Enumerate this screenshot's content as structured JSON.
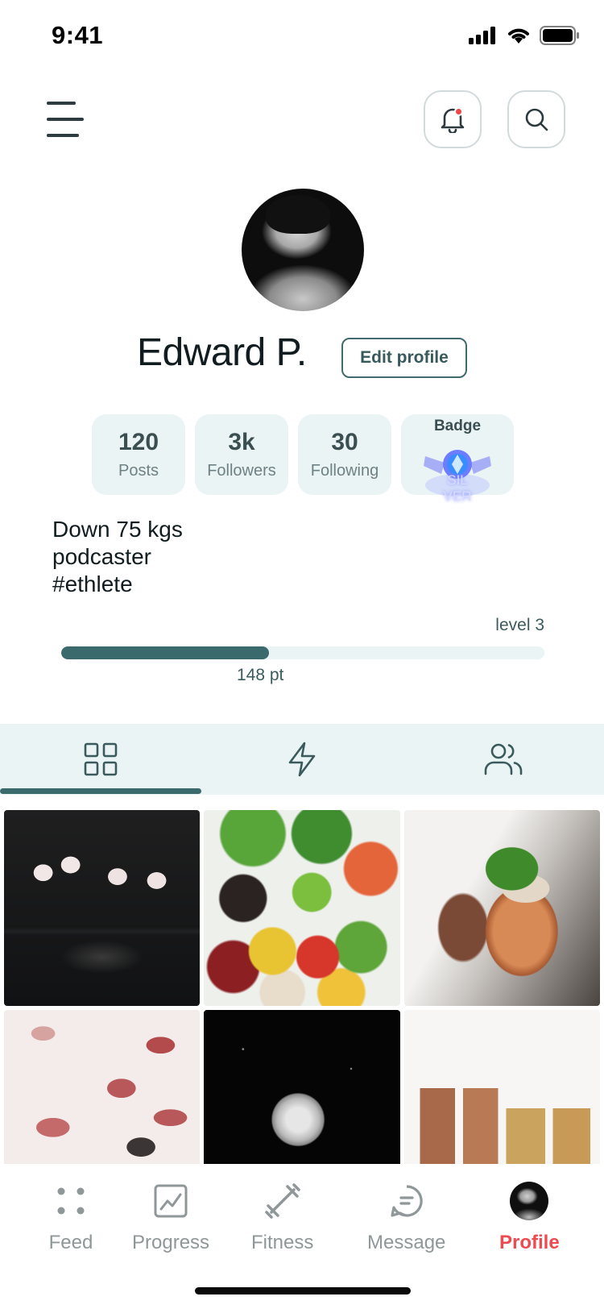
{
  "status_bar": {
    "time": "9:41"
  },
  "profile": {
    "name": "Edward P.",
    "edit_label": "Edit profile"
  },
  "stats": [
    {
      "value": "120",
      "label": "Posts"
    },
    {
      "value": "3k",
      "label": "Followers"
    },
    {
      "value": "30",
      "label": "Following"
    }
  ],
  "badge": {
    "label": "Badge",
    "text": "SIL\nVER"
  },
  "bio": [
    "Down 75 kgs",
    "podcaster",
    "#ethlete"
  ],
  "level": {
    "label": "level 3",
    "points": "148 pt",
    "progress_fraction": 0.43
  },
  "tabs": [
    {
      "icon": "grid-icon",
      "active": true
    },
    {
      "icon": "lightning-icon",
      "active": false
    },
    {
      "icon": "users-icon",
      "active": false
    }
  ],
  "photos": [
    "flamingo",
    "vegetables",
    "copper-mug-drink",
    "pink-leaves",
    "moon",
    "coin-stacks"
  ],
  "bottom_nav": [
    {
      "label": "Feed",
      "icon": "feed-dots-icon"
    },
    {
      "label": "Progress",
      "icon": "progress-chart-icon"
    },
    {
      "label": "Fitness",
      "icon": "dumbbell-icon"
    },
    {
      "label": "Message",
      "icon": "message-bubble-icon"
    },
    {
      "label": "Profile",
      "icon": "profile-avatar",
      "active": true
    }
  ],
  "colors": {
    "accent": "#3a6a6c",
    "card_bg": "#eaf4f4",
    "active_nav": "#ee4a52",
    "notification_dot": "#f04545"
  }
}
